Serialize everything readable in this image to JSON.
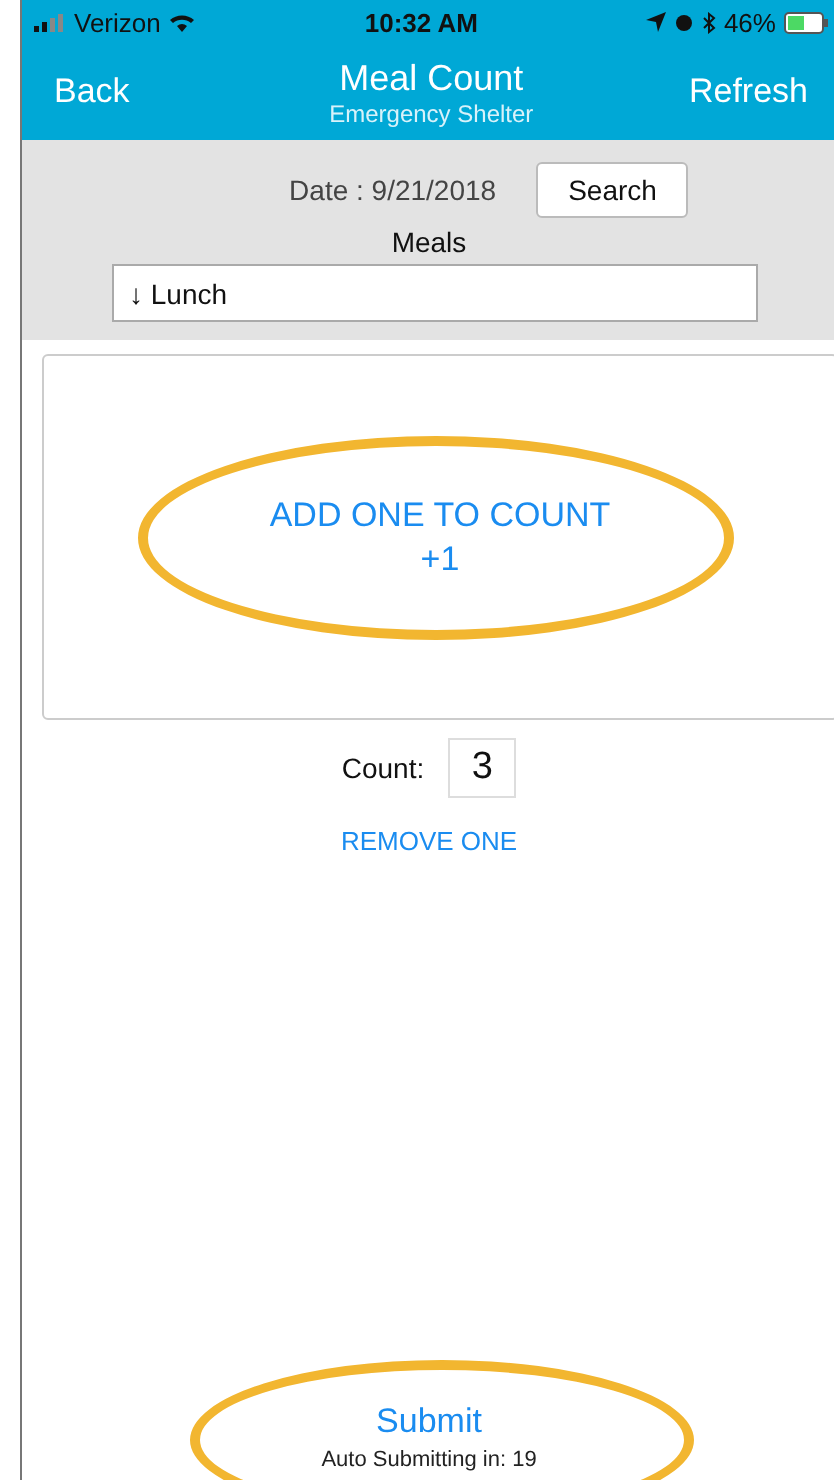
{
  "status_bar": {
    "carrier": "Verizon",
    "time": "10:32 AM",
    "battery": "46%"
  },
  "nav": {
    "back": "Back",
    "title": "Meal Count",
    "subtitle": "Emergency Shelter",
    "refresh": "Refresh"
  },
  "filter": {
    "date": "Date : 9/21/2018",
    "search": "Search",
    "meals_label": "Meals",
    "meal_value": "↓  Lunch"
  },
  "add_button": {
    "line1": "ADD ONE TO COUNT",
    "line2": "+1"
  },
  "count": {
    "label": "Count:",
    "value": "3"
  },
  "remove": "REMOVE ONE",
  "submit": "Submit",
  "auto_submit": "Auto Submitting in: 19"
}
